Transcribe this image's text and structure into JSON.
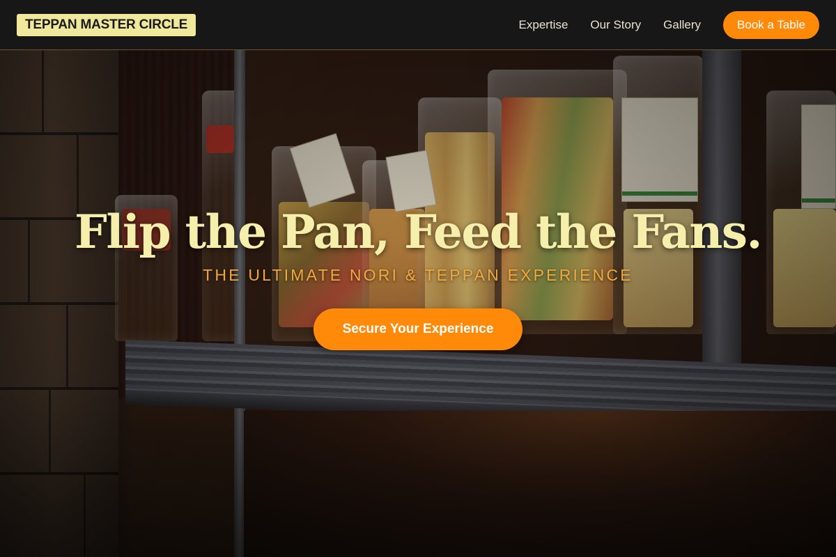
{
  "brand": {
    "name": "TEPPAN MASTER CIRCLE"
  },
  "nav": {
    "links": [
      {
        "label": "Expertise"
      },
      {
        "label": "Our Story"
      },
      {
        "label": "Gallery"
      }
    ],
    "cta_label": "Book a Table"
  },
  "hero": {
    "headline": "Flip the Pan, Feed the Fans.",
    "tagline": "THE ULTIMATE NORI & TEPPAN EXPERIENCE",
    "cta_label": "Secure Your Experience",
    "background": "pantry-shelf-with-pasta-bags-image"
  },
  "colors": {
    "accent": "#ff8a0a",
    "headline": "#f6efab",
    "tagline": "#f2a93b",
    "brand_bg": "#f0e89a",
    "nav_bg": "#181818"
  }
}
